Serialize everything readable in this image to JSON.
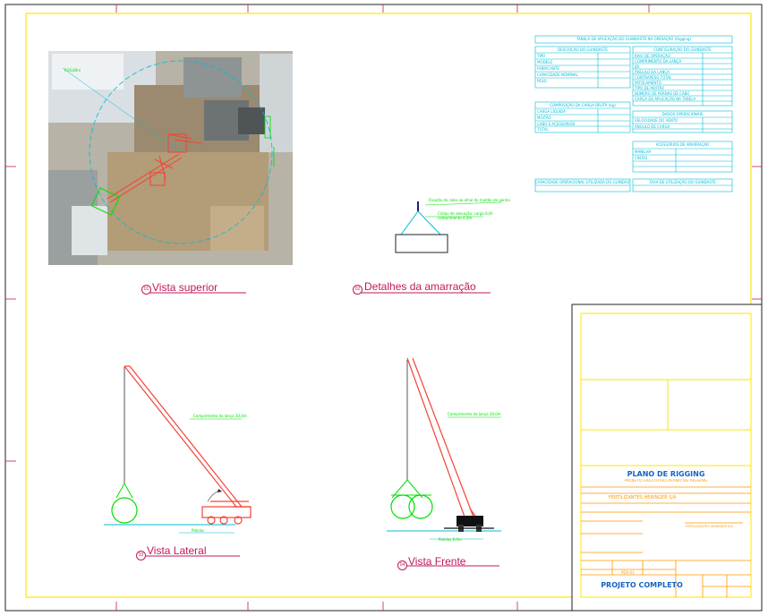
{
  "drawing": {
    "colors": {
      "frame": "#ffe600",
      "cyan": "#00bcd4",
      "red": "#f44336",
      "green": "#00e000",
      "magenta": "#c2185b",
      "titlebar": "#ff9800",
      "tb_blue": "#1565c0"
    }
  },
  "views": {
    "top": {
      "num": "01",
      "label": "Vista superior",
      "radius_note": "R16,80m"
    },
    "rigging": {
      "num": "02",
      "label": "Detalhes da amarração",
      "note1": "Fixação do cabo ao olhal do moitão de ganho",
      "note2": "Cintas de elevação: carga 8,0t - comprimento 4,0m"
    },
    "side": {
      "num": "03",
      "label": "Vista Lateral",
      "boom_note": "Comprimento da lança 30,0m",
      "ground_note": "Patolas"
    },
    "front": {
      "num": "04",
      "label": "Vista Frente",
      "boom_note": "Comprimento da lança 30,0m",
      "ground_note": "Patolas 6,0m"
    }
  },
  "tables": {
    "main_title": "TABELA DE APLICAÇÃO DO GUINDASTE NA OPERAÇÃO (Rigging)",
    "guindaste": {
      "title": "DESCRIÇÃO DO GUINDASTE",
      "rows": [
        "TIPO",
        "MODELO",
        "FABRICANTE",
        "CAPACIDADE NOMINAL",
        "PESO"
      ]
    },
    "config": {
      "title": "CONFIGURAÇÃO DO GUINDASTE",
      "rows": [
        "RAIO DE OPERAÇÃO",
        "COMPRIMENTO DA LANÇA",
        "JIB",
        "ÂNGULO DA LANÇA",
        "CONTRAPESO TOTAL",
        "PATOLAMENTO",
        "TIPO DE MOITÃO",
        "NÚMERO DE PERNAS DE CABO",
        "CARGA DE APLICAÇÃO NA TABELA"
      ]
    },
    "carga": {
      "title": "COMPOSIÇÃO DA CARGA BRUTA (kg)",
      "rows": [
        "CARGA LÍQUIDA",
        "MOITÃO",
        "CABO E ACESSÓRIOS",
        "TOTAL"
      ]
    },
    "dados": {
      "title": "DADOS OPERACIONAIS",
      "rows": [
        "VELOCIDADE DO VENTO",
        "ÂNGULO DE CARGA"
      ]
    },
    "acess": {
      "title": "ACESSÓRIOS DE AMARRAÇÃO",
      "rows": [
        "MANILHA",
        "CINTAS"
      ]
    },
    "cap": {
      "title": "CAPACIDADE OPERACIONAL UTILIZADA DO GUINDASTE"
    },
    "taxa": {
      "title": "TAXA DE UTILIZAÇÃO DO GUINDASTE"
    }
  },
  "title_block": {
    "plan_title": "PLANO DE RIGGING",
    "plan_subtitle": "PROJETO EXECUTIVO PLANO DE RIGGING",
    "company": "FERTILIZANTES HERINGER S/A",
    "company_right": "FERTILIZANTES HERINGER S/A",
    "project": "PROJETO COMPLETO",
    "code": "PDR-01"
  }
}
